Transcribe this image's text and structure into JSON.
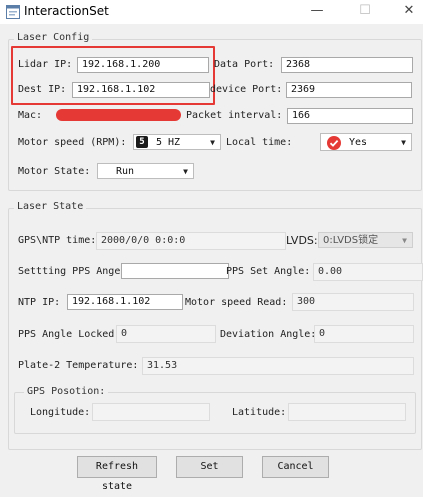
{
  "window": {
    "title": "InteractionSet",
    "minimize_glyph": "—",
    "maximize_glyph": "☐",
    "close_glyph": "✕"
  },
  "laser_config": {
    "group_title": "Laser Config",
    "lidar_ip_label": "Lidar IP:",
    "lidar_ip": "192.168.1.200",
    "data_port_label": "Data Port:",
    "data_port": "2368",
    "dest_ip_label": "Dest IP:",
    "dest_ip": "192.168.1.102",
    "device_port_label": "device Port:",
    "device_port": "2369",
    "mac_label": "Mac:",
    "packet_interval_label": "Packet interval:",
    "packet_interval": "166",
    "motor_speed_label": "Motor speed (RPM):",
    "motor_speed_badge": "5",
    "motor_speed_value": "5 HZ",
    "local_time_label": "Local time:",
    "local_time_value": "Yes",
    "motor_state_label": "Motor State:",
    "motor_state_value": "Run"
  },
  "laser_state": {
    "group_title": "Laser State",
    "gps_ntp_label": "GPS\\NTP time:",
    "gps_ntp_value": "2000/0/0 0:0:0",
    "lvds_label": "LVDS:",
    "lvds_value": "0:LVDS锁定",
    "setting_pps_label": "Settting PPS Ange",
    "setting_pps_value": "",
    "pps_set_angle_label": "PPS Set Angle:",
    "pps_set_angle_value": "0.00",
    "ntp_ip_label": "NTP IP:",
    "ntp_ip_value": "192.168.1.102",
    "motor_speed_read_label": "Motor speed Read:",
    "motor_speed_read_value": "300",
    "pps_locked_label": "PPS Angle Locked:",
    "pps_locked_value": "0",
    "deviation_label": "Deviation Angle:",
    "deviation_value": "0",
    "plate_temp_label": "Plate-2 Temperature:",
    "plate_temp_value": "31.53",
    "gps_position": {
      "group_title": "GPS Posotion:",
      "longitude_label": "Longitude:",
      "longitude_value": "",
      "latitude_label": "Latitude:",
      "latitude_value": ""
    }
  },
  "buttons": {
    "refresh": "Refresh state",
    "set": "Set",
    "cancel": "Cancel"
  },
  "colors": {
    "mac_redaction": "#e53935",
    "highlight_frame": "#e53935",
    "yes_check": "#e53935"
  },
  "icons": {
    "app": "window-app-icon",
    "yes": "red-check-circle-icon",
    "badge": "dark-number-badge"
  }
}
